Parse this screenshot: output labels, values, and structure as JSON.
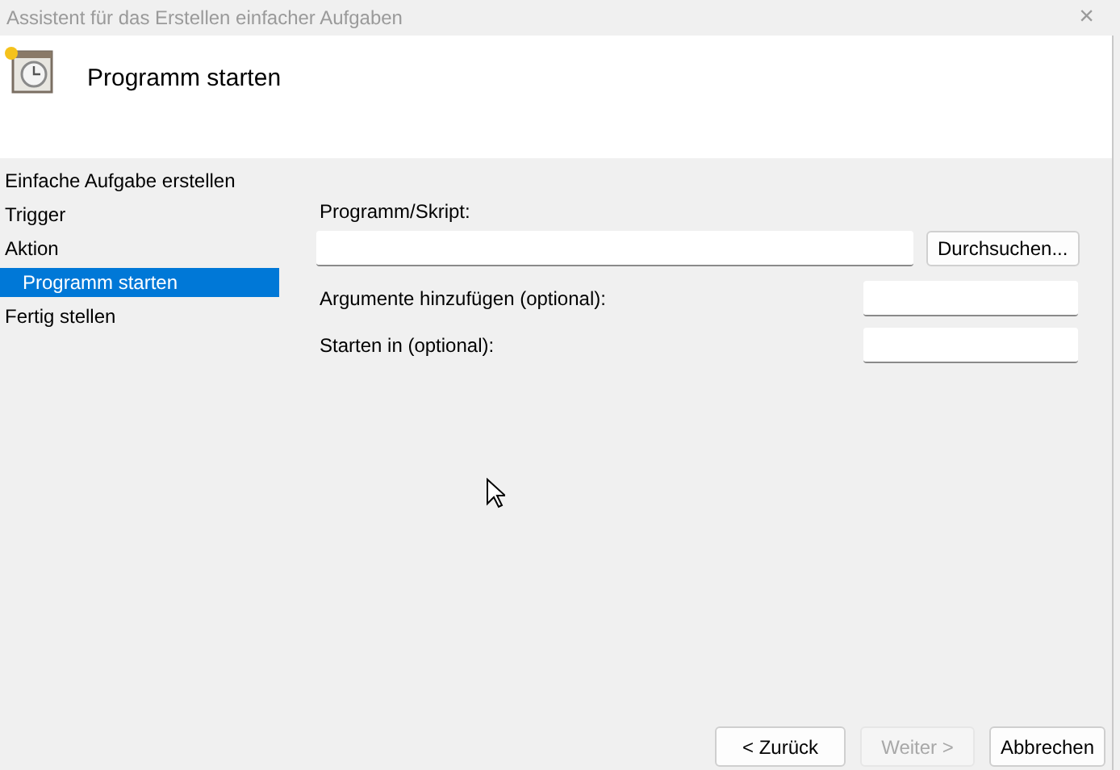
{
  "window": {
    "title": "Assistent für das Erstellen einfacher Aufgaben",
    "close": "×"
  },
  "header": {
    "title": "Programm starten"
  },
  "steps": [
    {
      "label": "Einfache Aufgabe erstellen",
      "selected": false
    },
    {
      "label": "Trigger",
      "selected": false
    },
    {
      "label": "Aktion",
      "selected": false,
      "children": [
        {
          "label": "Programm starten",
          "selected": true
        }
      ]
    },
    {
      "label": "Fertig stellen",
      "selected": false
    }
  ],
  "program": {
    "label": "Programm/Skript:",
    "browse": "Durchsuchen..."
  },
  "arguments": {
    "label": "Argumente hinzufügen (optional):"
  },
  "start_in": {
    "label": "Starten in (optional):"
  },
  "buttons": [
    {
      "label": "< Zurück",
      "disabled": false
    },
    {
      "label": "Weiter >",
      "disabled": true
    },
    {
      "label": "Abbrechen",
      "disabled": false
    }
  ]
}
